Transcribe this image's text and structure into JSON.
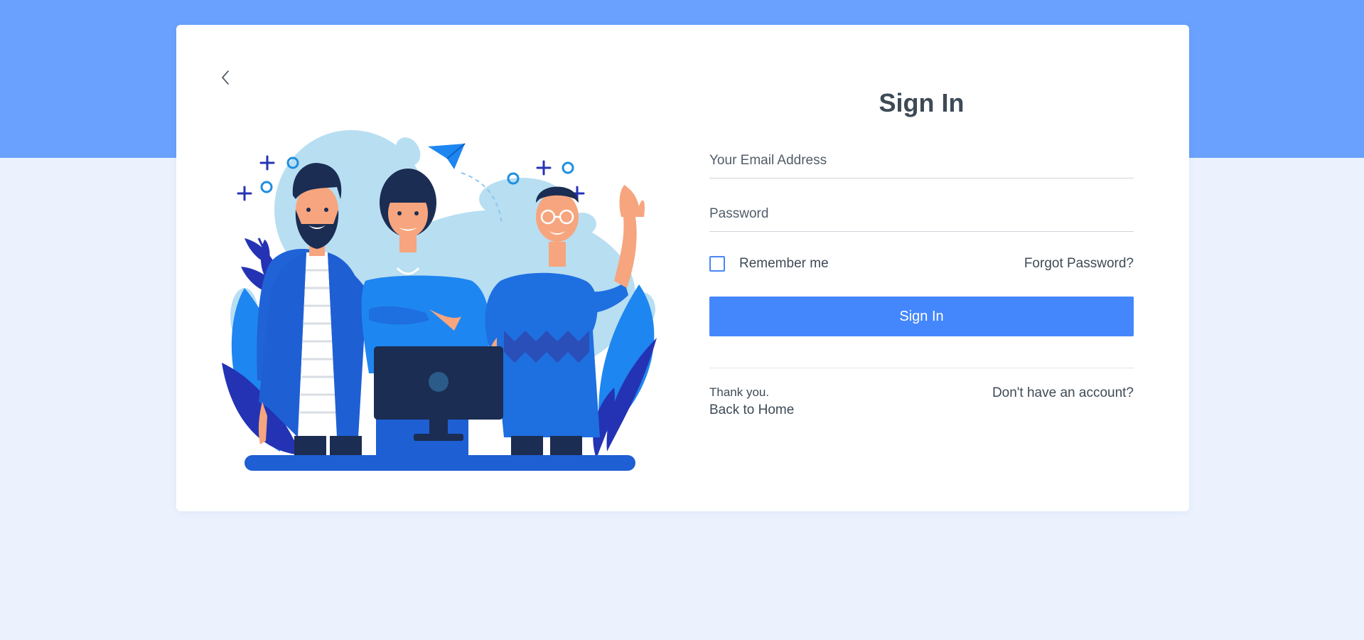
{
  "back_icon": "chevron-left-icon",
  "signin": {
    "title": "Sign In",
    "email_placeholder": "Your Email Address",
    "email_value": "",
    "password_placeholder": "Password",
    "password_value": "",
    "remember_label": "Remember me",
    "remember_checked": false,
    "forgot_label": "Forgot Password?",
    "button_label": "Sign In",
    "thanks_text": "Thank you.",
    "back_home_label": "Back to Home",
    "no_account_label": "Don't have an account?"
  },
  "colors": {
    "top_band": "#6aa1fe",
    "page_background": "#ebf2fe",
    "accent": "#4487fd",
    "text": "#3e4a56"
  }
}
